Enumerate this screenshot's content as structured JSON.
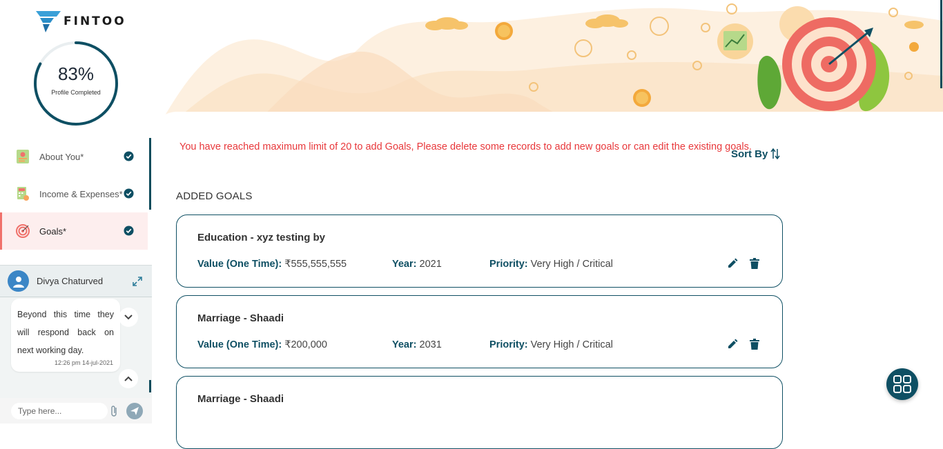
{
  "brand": {
    "name": "FINTOO"
  },
  "profile": {
    "percent": "83%",
    "label": "Profile Completed",
    "progress_fraction": 0.83
  },
  "nav": {
    "items": [
      {
        "label": "About You*",
        "icon": "about-you-icon",
        "completed": true
      },
      {
        "label": "Income & Expenses*",
        "icon": "income-expenses-icon",
        "completed": true
      },
      {
        "label": "Goals*",
        "icon": "goals-target-icon",
        "completed": true,
        "active": true
      }
    ]
  },
  "chat": {
    "agent_name": "Divya Chaturved",
    "message": "Beyond this time they will respond back on next working day.",
    "timestamp": "12:26 pm 14-jul-2021",
    "input_placeholder": "Type here..."
  },
  "main": {
    "warning": "You have reached maximum limit of 20 to add Goals, Please delete some records to add new goals or can edit the existing goals.",
    "sort_label": "Sort By",
    "section_title": "ADDED GOALS",
    "field_labels": {
      "value": "Value (One Time):",
      "year": "Year:",
      "priority": "Priority:"
    },
    "goals": [
      {
        "name": "Education - xyz testing by",
        "value": "₹555,555,555",
        "year": "2021",
        "priority": "Very High / Critical"
      },
      {
        "name": "Marriage - Shaadi",
        "value": "₹200,000",
        "year": "2031",
        "priority": "Very High / Critical"
      },
      {
        "name": "Marriage - Shaadi",
        "value": "",
        "year": "",
        "priority": ""
      }
    ]
  },
  "colors": {
    "primary": "#0e4f63",
    "warning": "#e8383b",
    "active_bg": "#fdeeee",
    "banner_bg": "#fdf0e0",
    "target_red": "#ee6b63"
  }
}
